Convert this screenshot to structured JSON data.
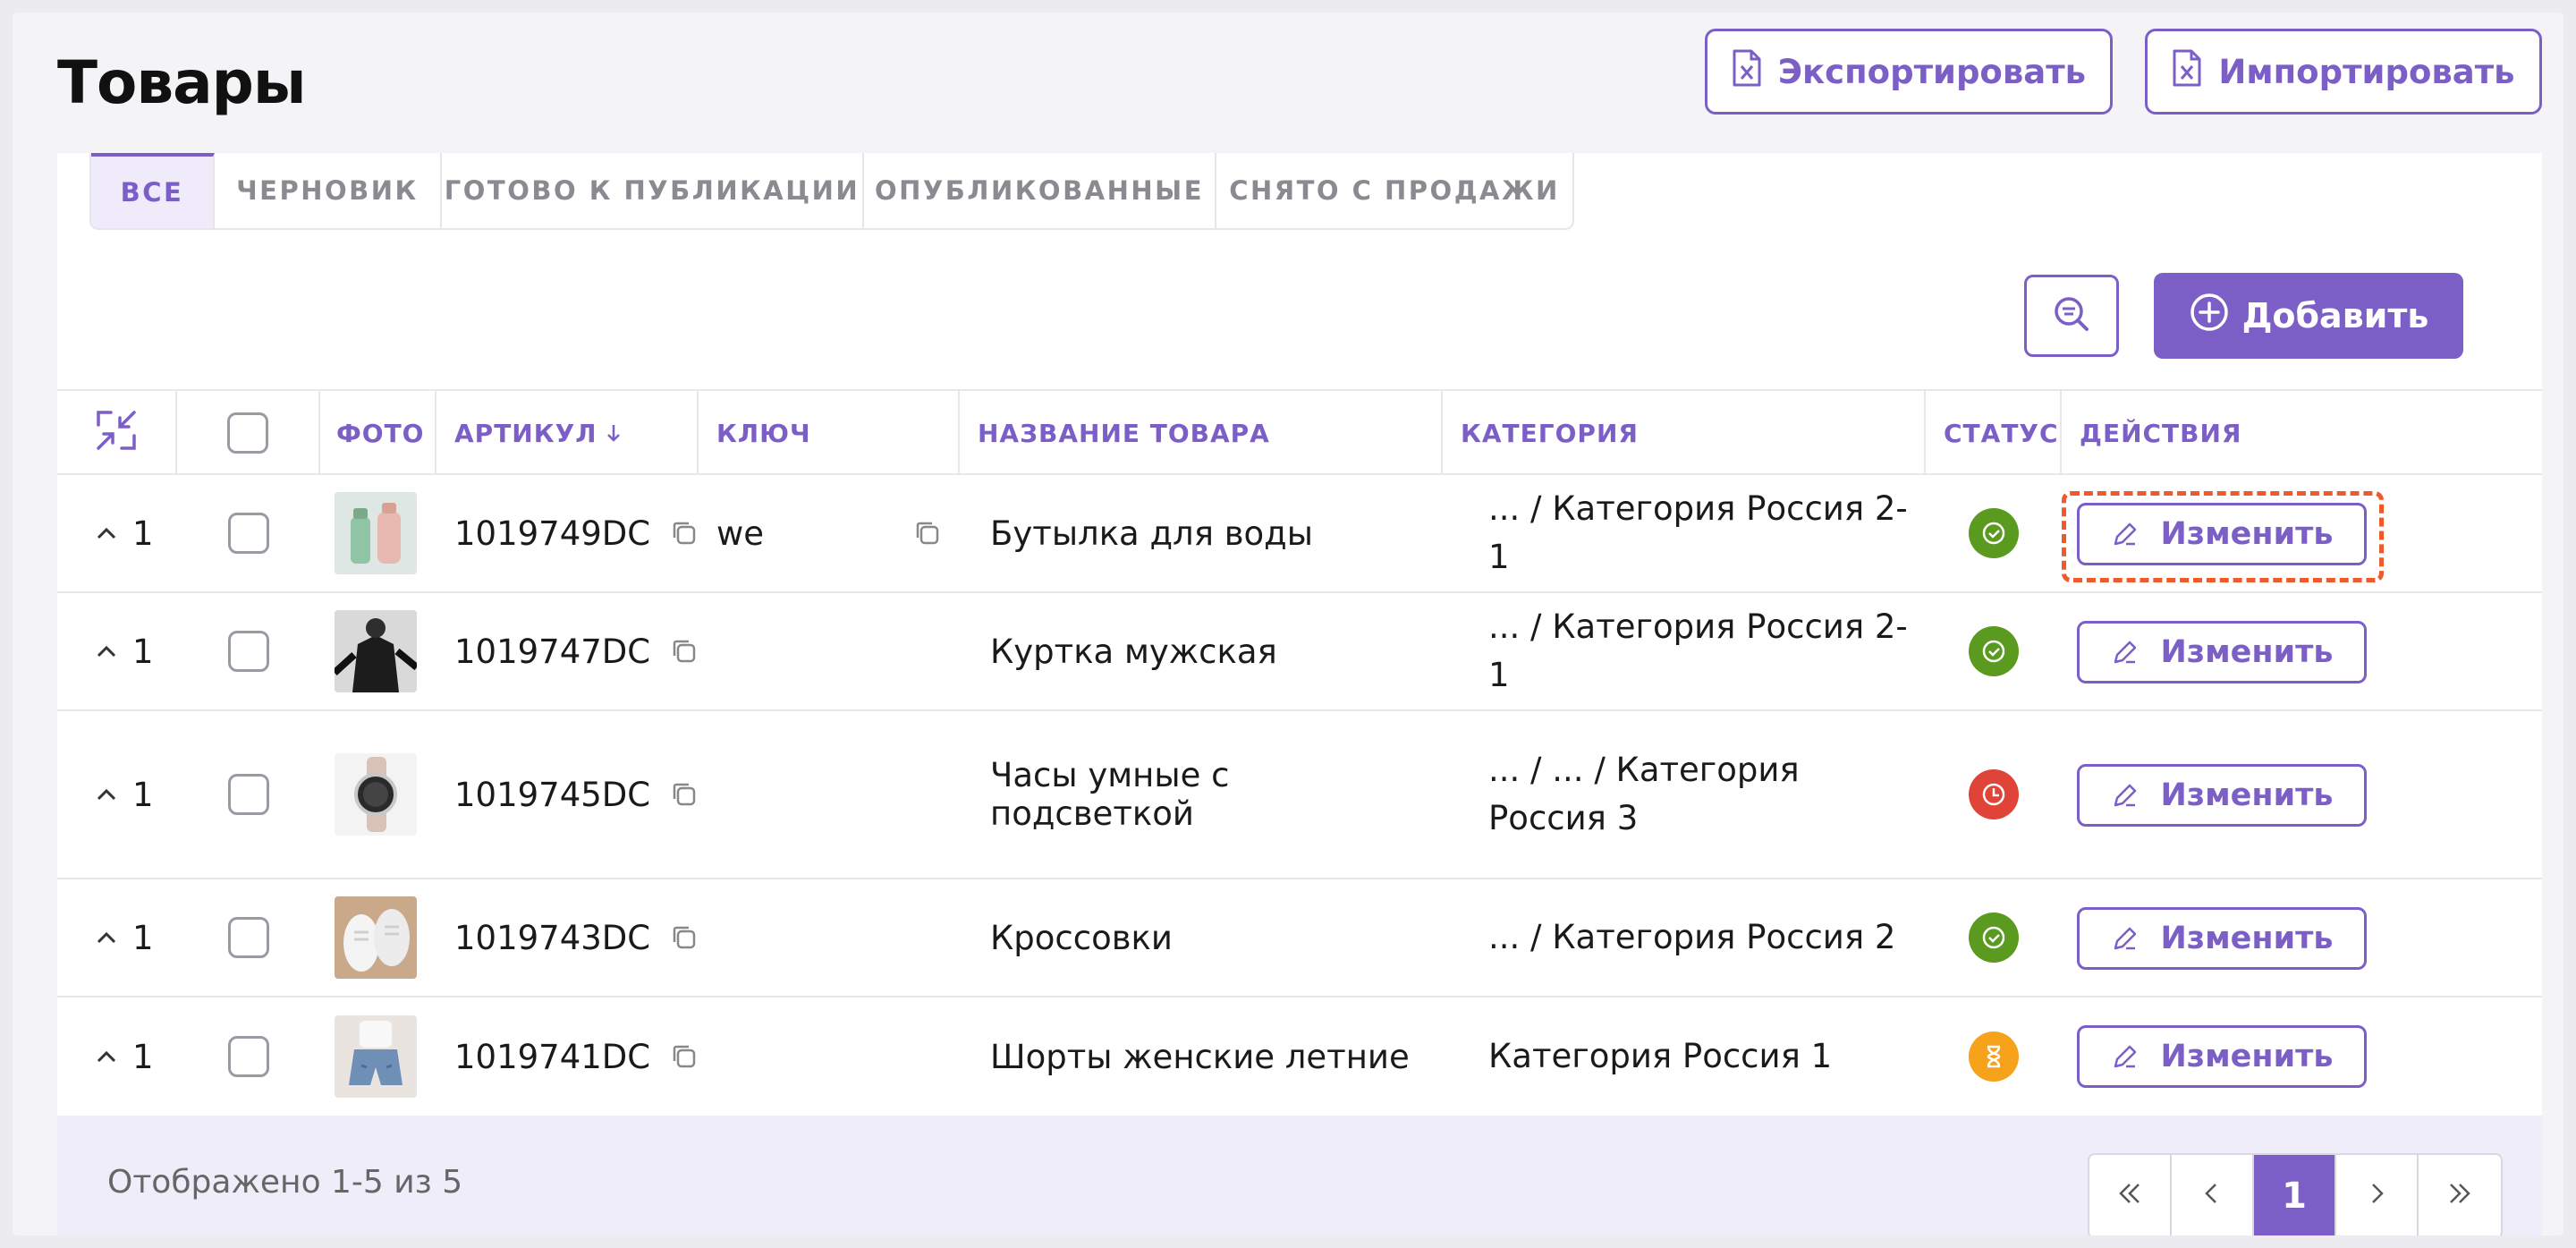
{
  "page": {
    "title": "Товары",
    "export_label": "Экспортировать",
    "import_label": "Импортировать"
  },
  "tabs": [
    {
      "label": "ВСЕ",
      "active": true
    },
    {
      "label": "ЧЕРНОВИК",
      "active": false
    },
    {
      "label": "ГОТОВО К ПУБЛИКАЦИИ",
      "active": false
    },
    {
      "label": "ОПУБЛИКОВАННЫЕ",
      "active": false
    },
    {
      "label": "СНЯТО С ПРОДАЖИ",
      "active": false
    }
  ],
  "toolbar": {
    "filter_icon": "search-filter-icon",
    "add_label": "Добавить"
  },
  "table": {
    "headers": {
      "photo": "ФОТО",
      "article": "АРТИКУЛ",
      "key": "КЛЮЧ",
      "name": "НАЗВАНИЕ ТОВАРА",
      "category": "КАТЕГОРИЯ",
      "status": "СТАТУС",
      "actions": "ДЕЙСТВИЯ"
    },
    "rows": [
      {
        "qty": "1",
        "article": "1019749DC",
        "key": "we",
        "name": "Бутылка для воды",
        "category": "... / Категория Россия 2-1",
        "status": "published",
        "edit": "Изменить",
        "photo": "bottle"
      },
      {
        "qty": "1",
        "article": "1019747DC",
        "key": "",
        "name": "Куртка мужская",
        "category": "... / Категория Россия 2-1",
        "status": "published",
        "edit": "Изменить",
        "photo": "jacket"
      },
      {
        "qty": "1",
        "article": "1019745DC",
        "key": "",
        "name": "Часы умные с подсветкой",
        "category": "... / ... / Категория Россия 3",
        "status": "unpublished",
        "edit": "Изменить",
        "photo": "watch"
      },
      {
        "qty": "1",
        "article": "1019743DC",
        "key": "",
        "name": "Кроссовки",
        "category": "... / Категория Россия 2",
        "status": "published",
        "edit": "Изменить",
        "photo": "sneakers"
      },
      {
        "qty": "1",
        "article": "1019741DC",
        "key": "",
        "name": "Шорты женские летние",
        "category": "Категория Россия 1",
        "status": "pending",
        "edit": "Изменить",
        "photo": "shorts"
      }
    ]
  },
  "status_colors": {
    "published": "#5a9a1e",
    "unpublished": "#e04438",
    "pending": "#f6a21a"
  },
  "footer": {
    "summary": "Отображено 1-5 из 5",
    "current_page": "1"
  }
}
